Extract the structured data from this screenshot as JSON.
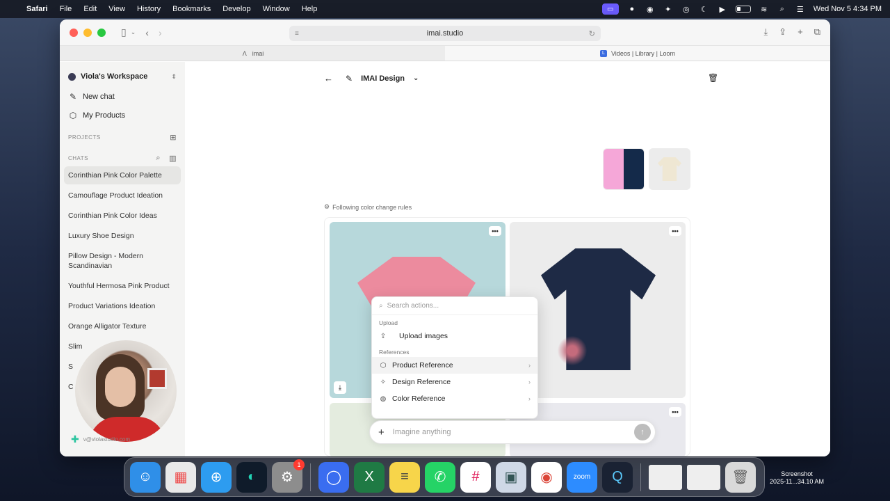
{
  "menubar": {
    "app_name": "Safari",
    "menus": [
      "File",
      "Edit",
      "View",
      "History",
      "Bookmarks",
      "Develop",
      "Window",
      "Help"
    ],
    "datetime": "Wed Nov 5  4:34 PM"
  },
  "browser": {
    "url": "imai.studio",
    "tabs": [
      {
        "title": "imai",
        "active": false
      },
      {
        "title": "Videos | Library | Loom",
        "active": true
      }
    ]
  },
  "sidebar": {
    "workspace": "Viola's Workspace",
    "nav": [
      {
        "label": "New chat",
        "icon": "edit-icon"
      },
      {
        "label": "My Products",
        "icon": "box-icon"
      }
    ],
    "projects_label": "PROJECTS",
    "chats_label": "CHATS",
    "chats": [
      "Corinthian Pink Color Palette",
      "Camouflage Product Ideation",
      "Corinthian Pink Color Ideas",
      "Luxury Shoe Design",
      "Pillow Design - Modern Scandinavian",
      "Youthful Hermosa Pink Product",
      "Product Variations Ideation",
      "Orange Alligator Texture",
      "Slim",
      "S",
      "C"
    ],
    "user_email": "v@violastudio.com"
  },
  "main": {
    "title": "IMAI Design",
    "rules_text": "Following color change rules",
    "swatch_colors": [
      "#f5a7d8",
      "#142a4a"
    ]
  },
  "popup": {
    "search_placeholder": "Search actions...",
    "upload_label": "Upload",
    "upload_item": "Upload images",
    "references_label": "References",
    "references": [
      "Product Reference",
      "Design Reference",
      "Color Reference"
    ]
  },
  "prompt": {
    "placeholder": "Imagine anything"
  },
  "dock": {
    "screenshot_label_1": "Screenshot",
    "screenshot_label_2": "2025-11...34.10 AM",
    "badge_count": "1"
  }
}
